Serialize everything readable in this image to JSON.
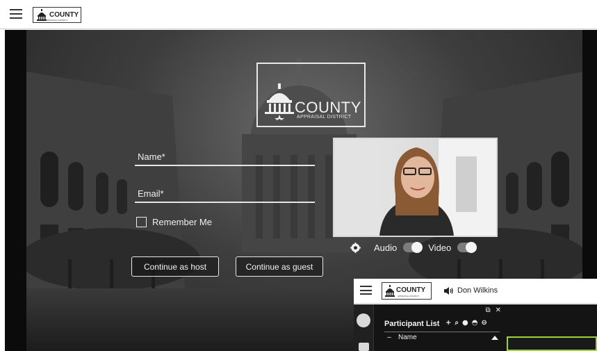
{
  "topbar": {
    "logo_word": "COUNTY",
    "logo_sub": "APPRAISAL DISTRICT"
  },
  "hero_logo": {
    "word": "COUNTY",
    "sub": "APPRAISAL DISTRICT"
  },
  "form": {
    "name_label": "Name*",
    "email_label": "Email*",
    "remember_label": "Remember Me",
    "host_button": "Continue as host",
    "guest_button": "Continue as guest"
  },
  "media": {
    "audio_label": "Audio",
    "video_label": "Video",
    "audio_on": true,
    "video_on": true
  },
  "overlay": {
    "logo_word": "COUNTY",
    "logo_sub": "APPRAISAL DISTRICT",
    "speaker_name": "Don Wilkins",
    "panel_title": "Participant List",
    "column_name": "Name",
    "highlight_color": "#9bd43b"
  },
  "icons": [
    "menu-icon",
    "capitol-dome-icon",
    "settings-gear-icon",
    "speaker-icon",
    "popout-icon",
    "close-icon",
    "add-icon",
    "search-icon",
    "info-icon",
    "people-icon",
    "chat-icon"
  ]
}
